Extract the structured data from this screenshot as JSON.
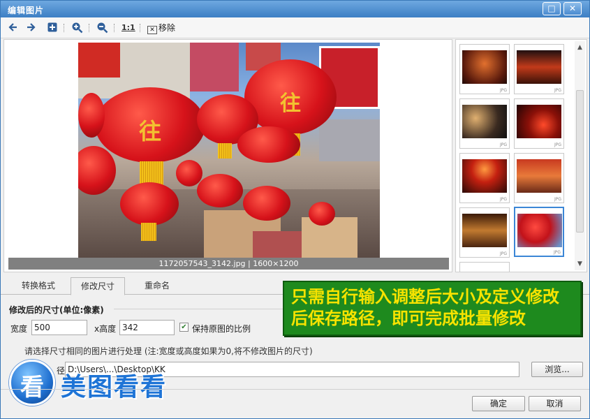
{
  "window": {
    "title": "编辑图片",
    "maximize_glyph": "□",
    "close_glyph": "✕"
  },
  "toolbar": {
    "back_icon": "arrow-left-icon",
    "forward_icon": "arrow-right-icon",
    "add_icon": "plus-box-icon",
    "zoom_in_icon": "zoom-in-icon",
    "zoom_out_icon": "zoom-out-icon",
    "actual_size_label": "1:1",
    "remove_label": "移除"
  },
  "preview": {
    "caption": "1172057543_3142.jpg | 1600×1200",
    "lantern_char": "往"
  },
  "thumbnails": {
    "tag": "JPG",
    "count": 9,
    "selected_index": 7
  },
  "tabs": [
    {
      "label": "转换格式"
    },
    {
      "label": "修改尺寸"
    },
    {
      "label": "重命名"
    }
  ],
  "active_tab": 1,
  "resize": {
    "group_title": "修改后的尺寸(单位:像素)",
    "width_label": "宽度",
    "width_value": "500",
    "height_label": "x高度",
    "height_value": "342",
    "keep_ratio_label": "保持原图的比例",
    "keep_ratio_checked": true,
    "note": "请选择尺寸相同的图片进行处理 (注:宽度或高度如果为0,将不修改图片的尺寸)",
    "path_label_partial": "径",
    "path_value": "D:\\Users\\...\\Desktop\\KK",
    "browse_label": "浏览..."
  },
  "banner": {
    "line1": "只需自行输入调整后大小及定义修改",
    "line2": "后保存路径，即可完成批量修改",
    "bg_color": "#1e8a1e",
    "text_color": "#f7e300"
  },
  "logo": {
    "mark": "看",
    "text": "美图看看"
  },
  "buttons": {
    "ok_label": "确定",
    "cancel_label": "取消"
  }
}
